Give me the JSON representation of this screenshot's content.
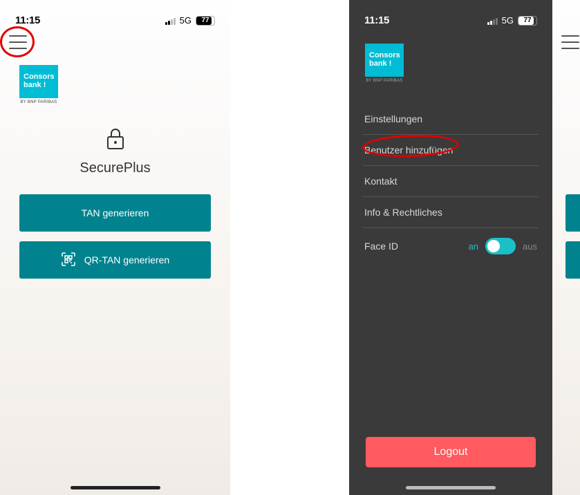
{
  "status_bar": {
    "time": "11:15",
    "network": "5G",
    "battery_percent": "77"
  },
  "logo": {
    "line1": "Consors",
    "line2": "bank !",
    "subtitle": "BY BNP PARIBAS"
  },
  "home": {
    "title": "SecurePlus",
    "tan_button": "TAN generieren",
    "qr_tan_button": "QR-TAN generieren"
  },
  "menu": {
    "items": [
      {
        "label": "Einstellungen"
      },
      {
        "label": "Benutzer hinzufügen"
      },
      {
        "label": "Kontakt"
      },
      {
        "label": "Info & Rechtliches"
      }
    ],
    "faceid": {
      "label": "Face ID",
      "on": "an",
      "off": "aus"
    },
    "logout": "Logout"
  }
}
